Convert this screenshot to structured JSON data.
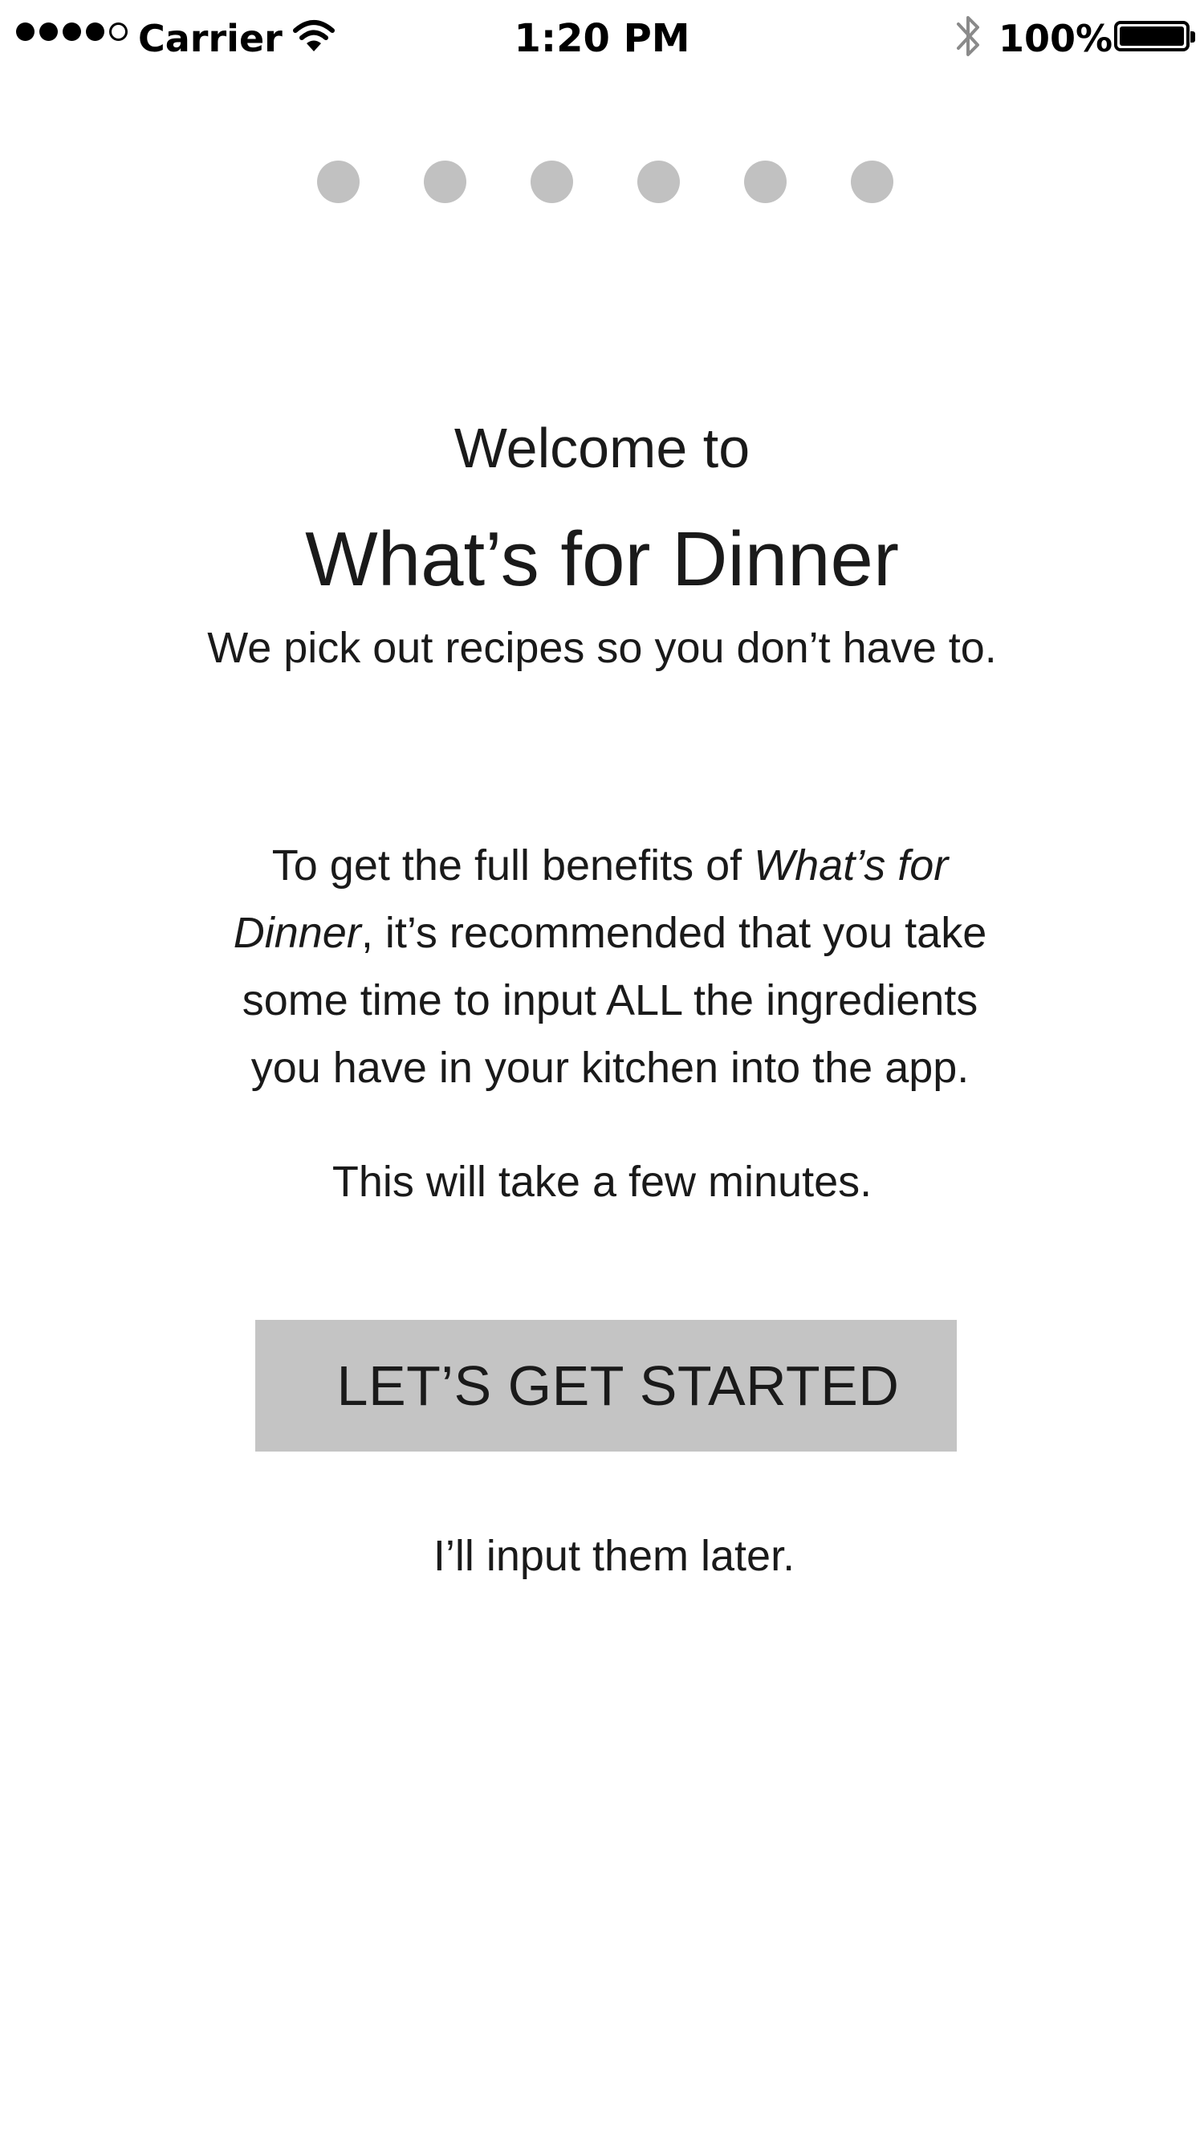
{
  "status_bar": {
    "carrier": "Carrier",
    "time": "1:20 PM",
    "battery_percent": "100%",
    "signal_bars_filled": 4,
    "signal_bars_total": 5,
    "icons": [
      "wifi-icon",
      "bluetooth-icon",
      "battery-icon"
    ]
  },
  "page_indicator": {
    "count": 6
  },
  "welcome": {
    "intro": "Welcome to",
    "app_name": "What’s for Dinner",
    "tagline": "We pick out recipes so you don’t have to."
  },
  "benefits": {
    "prefix": "To get the full benefits of ",
    "app_name_italic": "What’s for Dinner",
    "suffix": ", it’s recommended that you take some time to input ALL the ingredients you have in your kitchen into the app."
  },
  "time_note": "This will take a few minutes.",
  "actions": {
    "primary_label": "LET’S GET STARTED",
    "secondary_label": "I’ll input them later."
  },
  "colors": {
    "background": "#ffffff",
    "page_dot": "#c1c1c1",
    "button_background": "#c4c4c4",
    "text": "#1a1a1a"
  }
}
